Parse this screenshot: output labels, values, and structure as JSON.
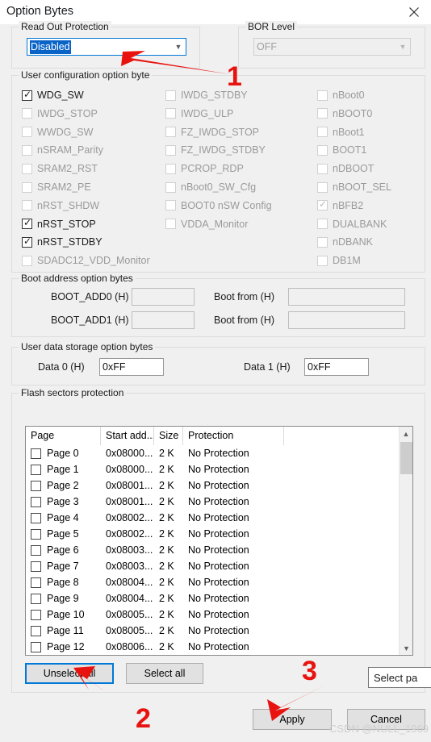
{
  "window": {
    "title": "Option Bytes",
    "close_icon": "close-icon"
  },
  "read_out_protection": {
    "legend": "Read Out Protection",
    "value": "Disabled",
    "arrow_icon": "chevron-down-icon"
  },
  "bor_level": {
    "legend": "BOR Level",
    "value": "OFF",
    "arrow_icon": "chevron-down-icon"
  },
  "user_config": {
    "legend": "User configuration option byte",
    "column1": [
      {
        "label": "WDG_SW",
        "checked": true,
        "enabled": true
      },
      {
        "label": "IWDG_STOP",
        "checked": false,
        "enabled": false
      },
      {
        "label": "WWDG_SW",
        "checked": false,
        "enabled": false
      },
      {
        "label": "nSRAM_Parity",
        "checked": false,
        "enabled": false
      },
      {
        "label": "SRAM2_RST",
        "checked": false,
        "enabled": false
      },
      {
        "label": "SRAM2_PE",
        "checked": false,
        "enabled": false
      },
      {
        "label": "nRST_SHDW",
        "checked": false,
        "enabled": false
      },
      {
        "label": "nRST_STOP",
        "checked": true,
        "enabled": true
      },
      {
        "label": "nRST_STDBY",
        "checked": true,
        "enabled": true
      },
      {
        "label": "SDADC12_VDD_Monitor",
        "checked": false,
        "enabled": false
      }
    ],
    "column2": [
      {
        "label": "IWDG_STDBY",
        "checked": false,
        "enabled": false
      },
      {
        "label": "IWDG_ULP",
        "checked": false,
        "enabled": false
      },
      {
        "label": "FZ_IWDG_STOP",
        "checked": false,
        "enabled": false
      },
      {
        "label": "FZ_IWDG_STDBY",
        "checked": false,
        "enabled": false
      },
      {
        "label": "PCROP_RDP",
        "checked": false,
        "enabled": false
      },
      {
        "label": "nBoot0_SW_Cfg",
        "checked": false,
        "enabled": false
      },
      {
        "label": "BOOT0 nSW Config",
        "checked": false,
        "enabled": false
      },
      {
        "label": "VDDA_Monitor",
        "checked": false,
        "enabled": false
      }
    ],
    "column3": [
      {
        "label": "nBoot0",
        "checked": false,
        "enabled": false
      },
      {
        "label": "nBOOT0",
        "checked": false,
        "enabled": false
      },
      {
        "label": "nBoot1",
        "checked": false,
        "enabled": false
      },
      {
        "label": "BOOT1",
        "checked": false,
        "enabled": false
      },
      {
        "label": "nDBOOT",
        "checked": false,
        "enabled": false
      },
      {
        "label": "nBOOT_SEL",
        "checked": false,
        "enabled": false
      },
      {
        "label": "nBFB2",
        "checked": true,
        "enabled": false
      },
      {
        "label": "DUALBANK",
        "checked": false,
        "enabled": false
      },
      {
        "label": "nDBANK",
        "checked": false,
        "enabled": false
      },
      {
        "label": "DB1M",
        "checked": false,
        "enabled": false
      }
    ]
  },
  "boot_address": {
    "legend": "Boot address option bytes",
    "rows": [
      {
        "label": "BOOT_ADD0 (H)",
        "value": "",
        "boot_from_label": "Boot from (H)",
        "boot_from_value": ""
      },
      {
        "label": "BOOT_ADD1 (H)",
        "value": "",
        "boot_from_label": "Boot from (H)",
        "boot_from_value": ""
      }
    ]
  },
  "user_data": {
    "legend": "User data storage option bytes",
    "data0_label": "Data 0 (H)",
    "data0_value": "0xFF",
    "data1_label": "Data 1 (H)",
    "data1_value": "0xFF"
  },
  "flash": {
    "legend": "Flash sectors protection",
    "columns": [
      "Page",
      "Start add...",
      "Size",
      "Protection",
      ""
    ],
    "rows": [
      {
        "page": "Page 0",
        "addr": "0x08000...",
        "size": "2 K",
        "protection": "No Protection",
        "checked": false
      },
      {
        "page": "Page 1",
        "addr": "0x08000...",
        "size": "2 K",
        "protection": "No Protection",
        "checked": false
      },
      {
        "page": "Page 2",
        "addr": "0x08001...",
        "size": "2 K",
        "protection": "No Protection",
        "checked": false
      },
      {
        "page": "Page 3",
        "addr": "0x08001...",
        "size": "2 K",
        "protection": "No Protection",
        "checked": false
      },
      {
        "page": "Page 4",
        "addr": "0x08002...",
        "size": "2 K",
        "protection": "No Protection",
        "checked": false
      },
      {
        "page": "Page 5",
        "addr": "0x08002...",
        "size": "2 K",
        "protection": "No Protection",
        "checked": false
      },
      {
        "page": "Page 6",
        "addr": "0x08003...",
        "size": "2 K",
        "protection": "No Protection",
        "checked": false
      },
      {
        "page": "Page 7",
        "addr": "0x08003...",
        "size": "2 K",
        "protection": "No Protection",
        "checked": false
      },
      {
        "page": "Page 8",
        "addr": "0x08004...",
        "size": "2 K",
        "protection": "No Protection",
        "checked": false
      },
      {
        "page": "Page 9",
        "addr": "0x08004...",
        "size": "2 K",
        "protection": "No Protection",
        "checked": false
      },
      {
        "page": "Page 10",
        "addr": "0x08005...",
        "size": "2 K",
        "protection": "No Protection",
        "checked": false
      },
      {
        "page": "Page 11",
        "addr": "0x08005...",
        "size": "2 K",
        "protection": "No Protection",
        "checked": false
      },
      {
        "page": "Page 12",
        "addr": "0x08006...",
        "size": "2 K",
        "protection": "No Protection",
        "checked": false
      }
    ],
    "unselect_all_label": "Unselect all",
    "select_all_label": "Select all",
    "scroll_up_icon": "chevron-up-icon",
    "scroll_down_icon": "chevron-down-icon"
  },
  "tooltip": {
    "text": "Select pa"
  },
  "footer": {
    "apply_label": "Apply",
    "cancel_label": "Cancel"
  },
  "annotations": {
    "accent_color": "#e8130f",
    "marks": [
      {
        "number": "1",
        "target": "read-out-protection-combo"
      },
      {
        "number": "2",
        "target": "unselect-all-button"
      },
      {
        "number": "3",
        "target": "apply-button"
      }
    ]
  },
  "watermark": {
    "text": "CSDN @NULL_1969"
  }
}
